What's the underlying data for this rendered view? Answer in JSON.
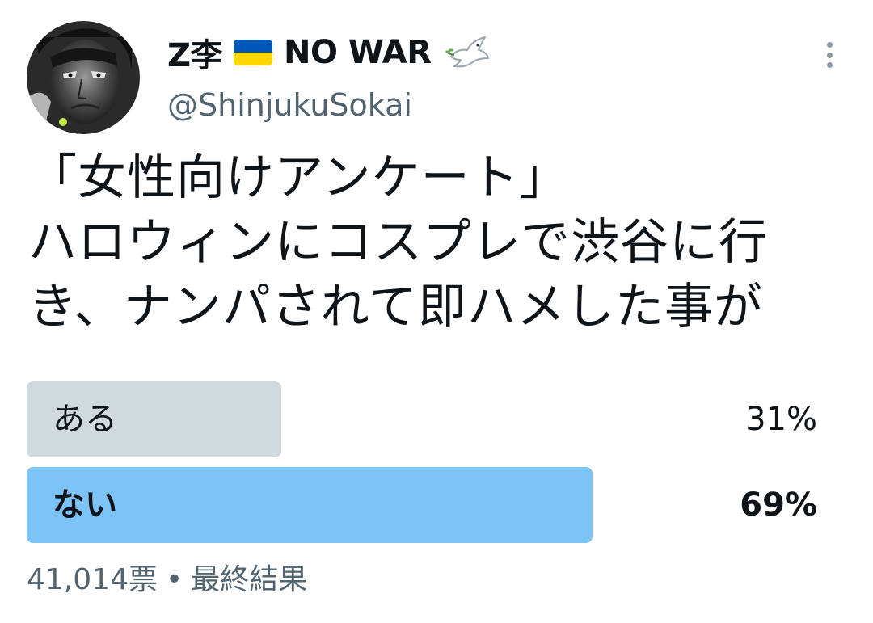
{
  "author": {
    "display_name": "Z李",
    "display_name_suffix": "NO WAR",
    "handle": "@ShinjukuSokai",
    "flag_icon": "ukraine-flag-icon",
    "dove_icon": "peace-dove-icon"
  },
  "tweet": {
    "lines": [
      "「女性向けアンケート」",
      "ハロウィンにコスプレで渋谷に行",
      "き、ナンパされて即ハメした事が"
    ]
  },
  "poll": {
    "options": [
      {
        "label": "ある",
        "percent": "31%",
        "fraction": 0.31,
        "winner": false
      },
      {
        "label": "ない",
        "percent": "69%",
        "fraction": 0.69,
        "winner": true
      }
    ],
    "votes": "41,014票",
    "separator": "•",
    "status": "最終結果"
  },
  "colors": {
    "bar_default": "#cfd9de",
    "bar_winner": "#7cc3f6",
    "secondary_text": "#536471",
    "flag_blue": "#0057b7",
    "flag_yellow": "#ffd700"
  }
}
